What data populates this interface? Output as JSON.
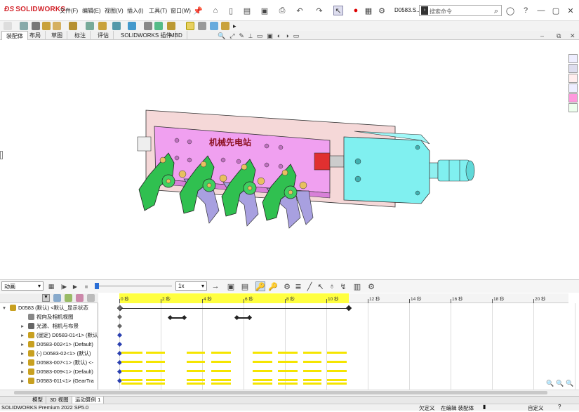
{
  "app": {
    "brand": "SOLIDWORKS",
    "doc_name": "D0583.S...",
    "search_placeholder": "搜索命令"
  },
  "menu": [
    "文件(F)",
    "编辑(E)",
    "视图(V)",
    "插入(I)",
    "工具(T)",
    "窗口(W)"
  ],
  "tabs": [
    {
      "label": "装配体",
      "active": true
    },
    {
      "label": "布局",
      "active": false
    },
    {
      "label": "草图",
      "active": false
    },
    {
      "label": "标注",
      "active": false
    },
    {
      "label": "评估",
      "active": false
    },
    {
      "label": "SOLIDWORKS 插件",
      "active": false
    },
    {
      "label": "MBD",
      "active": false
    }
  ],
  "model": {
    "stamp_text": "机械先电站"
  },
  "motion": {
    "study_type": "动画",
    "speed": "1x"
  },
  "timeline": {
    "ticks": [
      "0 秒",
      "2 秒",
      "4 秒",
      "6 秒",
      "8 秒",
      "10 秒",
      "12 秒",
      "14 秒",
      "16 秒",
      "18 秒",
      "20 秒"
    ]
  },
  "tree": {
    "items": [
      {
        "label": "D0583 (默认) <默认_显示状态",
        "arrow": "▾",
        "indent": 0,
        "icon": "assembly-icon",
        "color": "#c8a020"
      },
      {
        "label": "视向及相机视图",
        "arrow": "",
        "indent": 1,
        "icon": "camera-icon",
        "color": "#888888"
      },
      {
        "label": "光源、相机与布景",
        "arrow": "▸",
        "indent": 1,
        "icon": "lights-icon",
        "color": "#666666"
      },
      {
        "label": "(固定) D0583-01<1> (默认",
        "arrow": "▸",
        "indent": 1,
        "icon": "part-icon",
        "color": "#c8a020"
      },
      {
        "label": "D0583-002<1> (Default)",
        "arrow": "▸",
        "indent": 1,
        "icon": "part-icon",
        "color": "#c8a020"
      },
      {
        "label": "(-) D0583-02<1> (默认)",
        "arrow": "▸",
        "indent": 1,
        "icon": "part-icon",
        "color": "#c8a020"
      },
      {
        "label": "D0583-007<1> (默认) <-",
        "arrow": "▸",
        "indent": 1,
        "icon": "part-icon",
        "color": "#c8a020"
      },
      {
        "label": "D0583-009<1> (Default)",
        "arrow": "▸",
        "indent": 1,
        "icon": "part-icon",
        "color": "#c8a020"
      },
      {
        "label": "D0583-011<1> (GearTra",
        "arrow": "▸",
        "indent": 1,
        "icon": "part-icon",
        "color": "#c8a020"
      }
    ]
  },
  "bottom_tabs": [
    {
      "label": "模型",
      "active": false
    },
    {
      "label": "3D 视图",
      "active": false
    },
    {
      "label": "运动算例 1",
      "active": true
    }
  ],
  "status": {
    "left": "SOLIDWORKS Premium 2022 SP5.0",
    "s1": "欠定义",
    "s2": "在编辑 装配体",
    "s3": "自定义"
  },
  "colors": {
    "brand_red": "#d2232a",
    "timeline_yellow": "#ffff40",
    "key_bar_yellow": "#f5e500",
    "plate_pink": "#f0a0f0",
    "cylinder_cyan": "#80f0f0",
    "finger_green": "#30c050",
    "finger_lavender": "#a8a0e0"
  }
}
